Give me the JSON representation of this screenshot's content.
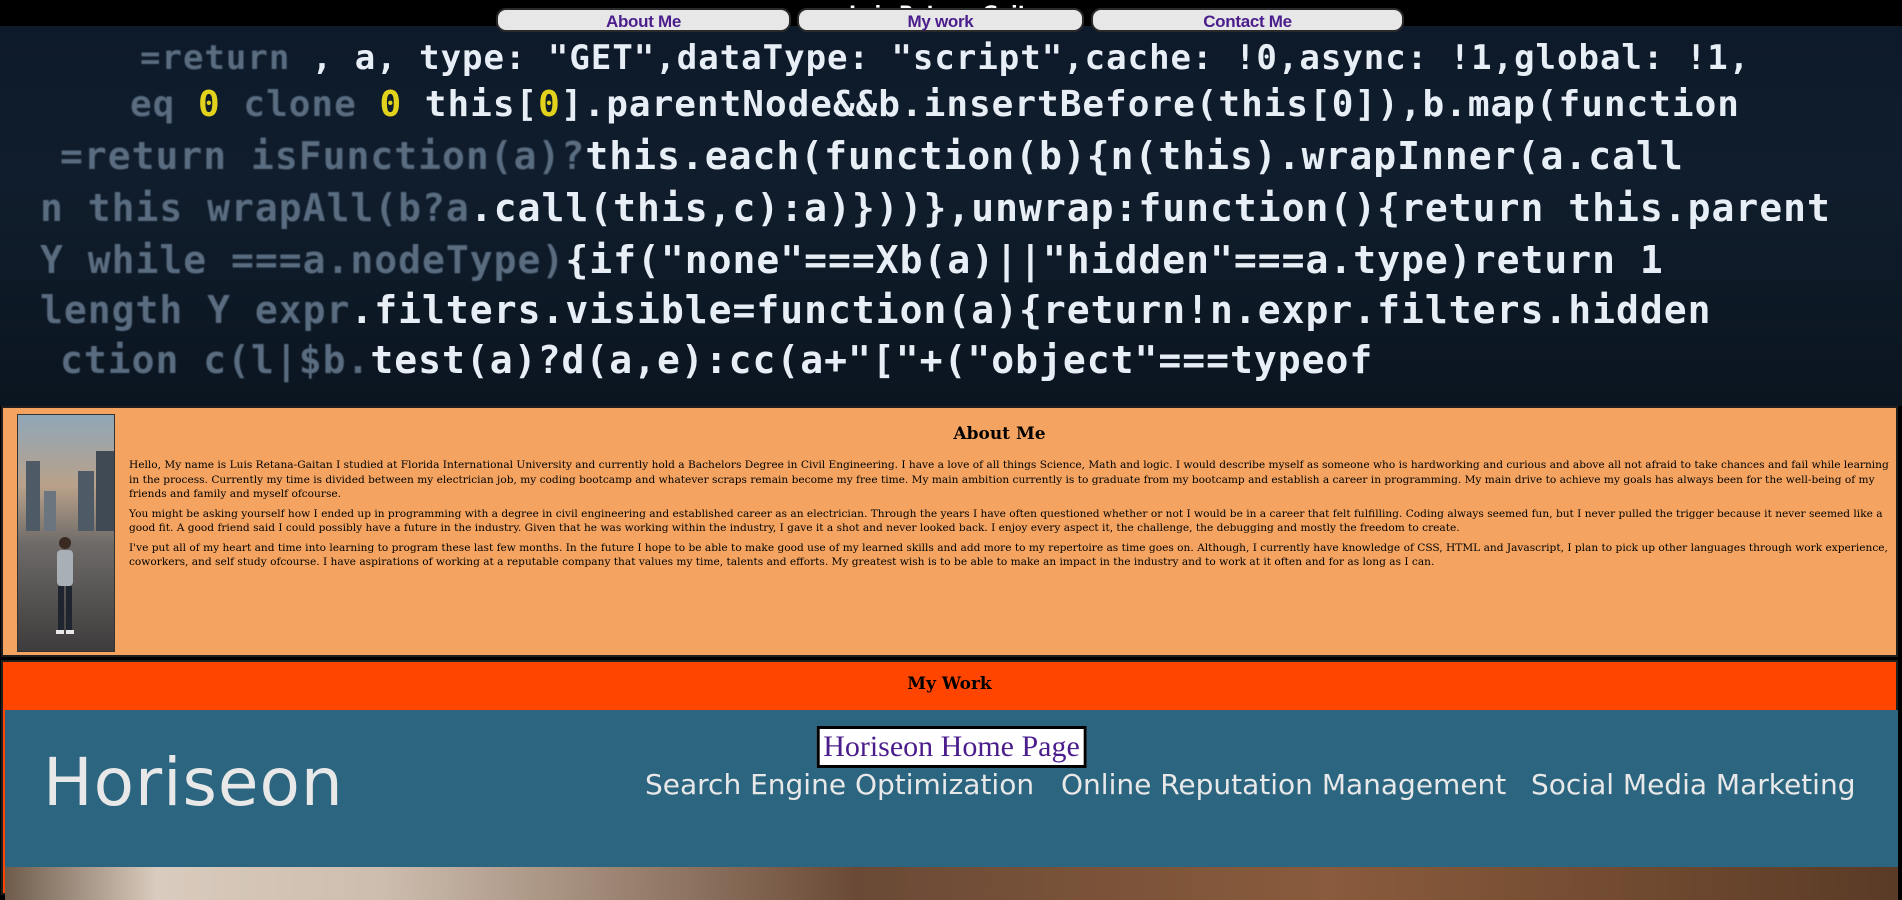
{
  "header": {
    "title": "Luis Retana-Gaitan"
  },
  "nav": [
    {
      "label": "About Me"
    },
    {
      "label": "My work"
    },
    {
      "label": "Contact Me"
    }
  ],
  "hero": {
    "lines": [
      ", a, type: \"GET\",dataType: \"script\",cache: !0,async: !1,global: !1,",
      ".parentNode&&b.insertBefore(this[0]),b.map(function",
      "this.each(function(b){n(this).wrapInner(a.call",
      ".call(this,c):a)}))},unwrap:function(){return this.parent",
      "{if(\"none\"===Xb(a)||\"hidden\"===a.type)return 1",
      ".filters.visible=function(a){return!n.expr.filters.hidden",
      "test(a)?d(a,e):cc(a+\"[\"+(\"object\"===typeof"
    ]
  },
  "about": {
    "title": "About Me",
    "paragraphs": [
      "Hello, My name is Luis Retana-Gaitan I studied at Florida International University and currently hold a Bachelors Degree in Civil Engineering. I have a love of all things Science, Math and logic. I would describe myself as someone who is hardworking and curious and above all not afraid to take chances and fail while learning in the process. Currently my time is divided between my electrician job, my coding bootcamp and whatever scraps remain become my free time. My main ambition currently is to graduate from my bootcamp and establish a career in programming. My main drive to achieve my goals has always been for the well-being of my friends and family and myself ofcourse.",
      "You might be asking yourself how I ended up in programming with a degree in civil engineering and established career as an electrician. Through the years I have often questioned whether or not I would be in a career that felt fulfilling. Coding always seemed fun, but I never pulled the trigger because it never seemed like a good fit. A good friend said I could possibly have a future in the industry. Given that he was working within the industry, I gave it a shot and never looked back. I enjoy every aspect it, the challenge, the debugging and mostly the freedom to create.",
      "I've put all of my heart and time into learning to program these last few months. In the future I hope to be able to make good use of my learned skills and add more to my repertoire as time goes on. Although, I currently have knowledge of CSS, HTML and Javascript, I plan to pick up other languages through work experience, coworkers, and self study ofcourse. I have aspirations of working at a reputable company that values my time, talents and efforts. My greatest wish is to be able to make an impact in the industry and to work at it often and for as long as I can."
    ]
  },
  "work": {
    "title": "My Work",
    "project": {
      "link_label": "Horiseon Home Page",
      "brand": "Horiseon",
      "nav": [
        "Search Engine Optimization",
        "Online Reputation Management",
        "Social Media Marketing"
      ]
    }
  },
  "colors": {
    "about_bg": "#f4a460",
    "work_bg": "#ff4500",
    "nav_text": "#4b1d8c",
    "project_bg": "#2b6580"
  }
}
